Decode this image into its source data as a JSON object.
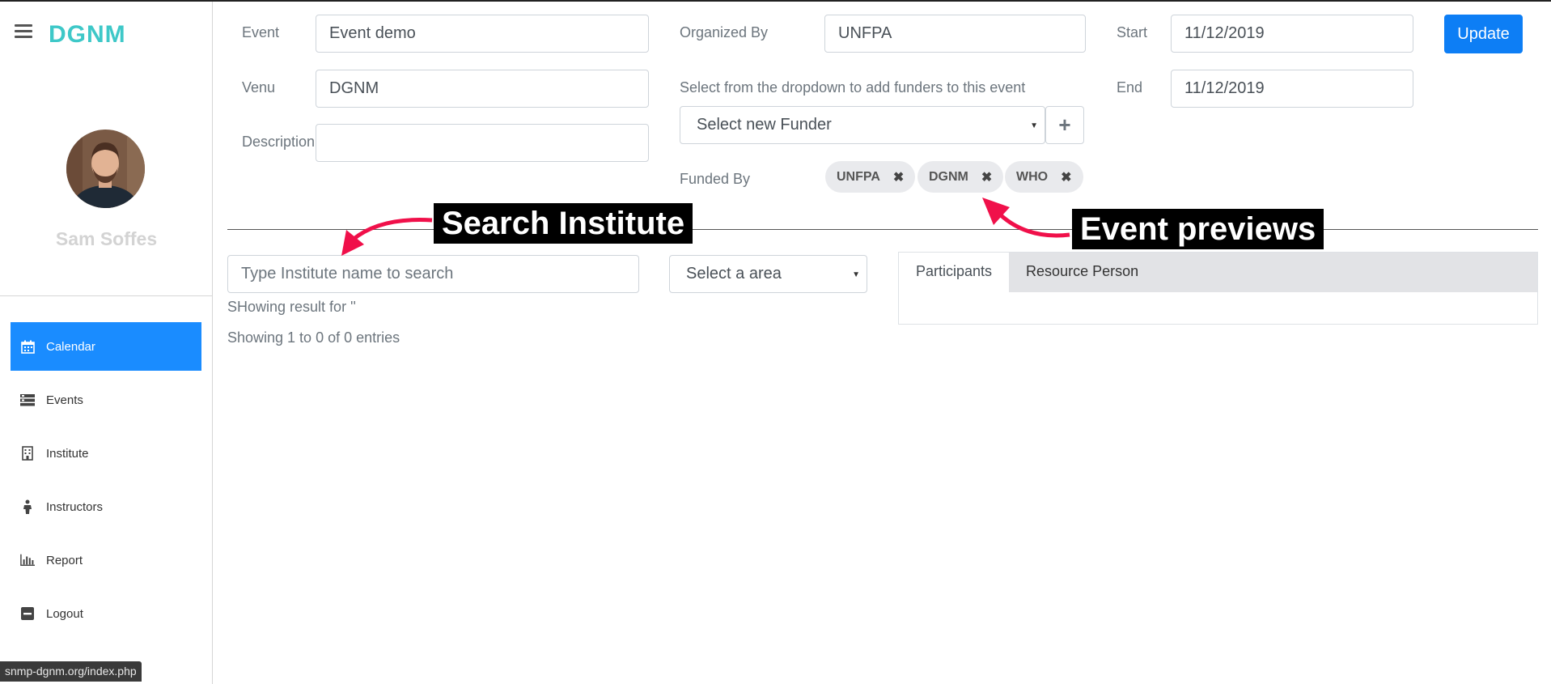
{
  "sidebar": {
    "brand": "DGNM",
    "username": "Sam Soffes",
    "items": [
      {
        "label": "Calendar",
        "icon": "calendar-icon"
      },
      {
        "label": "Events",
        "icon": "events-icon"
      },
      {
        "label": "Institute",
        "icon": "building-icon"
      },
      {
        "label": "Instructors",
        "icon": "person-icon"
      },
      {
        "label": "Report",
        "icon": "bar-chart-icon"
      },
      {
        "label": "Logout",
        "icon": "minus-square-icon"
      }
    ],
    "active_item": "Calendar",
    "status_url": "snmp-dgnm.org/index.php"
  },
  "form": {
    "event_label": "Event",
    "event_value": "Event demo",
    "venue_label": "Venu",
    "venue_value": "DGNM",
    "description_label": "Description",
    "description_value": "",
    "organized_label": "Organized By",
    "organized_value": "UNFPA",
    "funder_hint": "Select from the dropdown to add funders to this event",
    "funder_select": "Select new Funder",
    "funded_by_label": "Funded By",
    "funders": [
      "UNFPA",
      "DGNM",
      "WHO"
    ],
    "start_label": "Start",
    "start_value": "11/12/2019",
    "end_label": "End",
    "end_value": "11/12/2019",
    "update_label": "Update"
  },
  "search": {
    "placeholder": "Type Institute name to search",
    "area_select": "Select a area",
    "result_text": "SHowing result for ''",
    "entries_text": "Showing 1 to 0 of 0 entries"
  },
  "tabs": [
    "Participants",
    "Resource Person"
  ],
  "annotations": {
    "search_institute": "Search Institute",
    "event_previews": "Event previews"
  },
  "colors": {
    "brand": "#3ec8c8",
    "primary": "#0d7ef5",
    "active_nav": "#1a8cff",
    "annotation_arrow": "#f0104a"
  }
}
